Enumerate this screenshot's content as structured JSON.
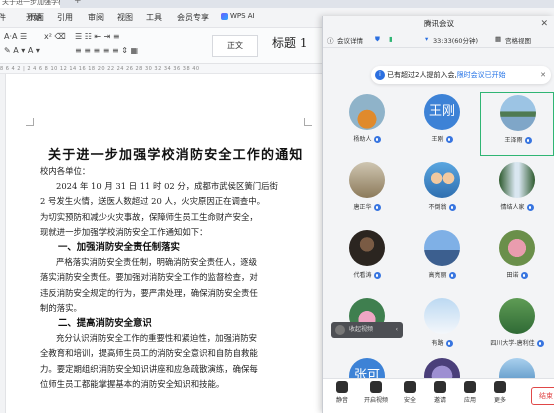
{
  "wps": {
    "file_tab": "关于进一步加强学校消防安全",
    "menu": [
      "文件",
      "开始",
      "插入",
      "页面",
      "引用",
      "审阅",
      "视图",
      "工具",
      "会员专享"
    ],
    "wps_ai": "WPS AI",
    "style_normal": "正文",
    "style_heading1": "标题 1",
    "ruler_text": "8 6 4 2 | 2 4 6 8 10 12 14 16 18 20 22 24 26 28 30 32 34 36 38 40",
    "document": {
      "title": "关于进一步加强学校消防安全工作的通知",
      "salutation": "校内各单位：",
      "para1": [
        "2024 年 10 月 31 日 11 时 02 分，成都市武侯区簧门后街",
        "2 号发生火情，送医人数超过 20 人，火灾原因正在调查中。",
        "为切实预防和减少火灾事故，保障师生员工生命财产安全，",
        "现就进一步加强学校消防安全工作通知如下："
      ],
      "heading1": "一、加强消防安全责任制落实",
      "para2": [
        "严格落实消防安全责任制，明确消防安全责任人，逐级",
        "落实消防安全责任。要加强对消防安全工作的监督检查，对",
        "违反消防安全规定的行为，要严肃处理，确保消防安全责任",
        "制的落实。"
      ],
      "heading2": "二、提高消防安全意识",
      "para3": [
        "充分认识消防安全工作的重要性和紧迫性，加强消防安",
        "全教育和培训，提高师生员工的消防安全意识和自防自救能",
        "力。要定期组织消防安全知识讲座和应急疏散演练，确保每",
        "位师生员工都能掌握基本的消防安全知识和技能。"
      ]
    }
  },
  "meeting": {
    "title": "腾讯会议",
    "bar": {
      "details": "会议详情",
      "timer": "33:33(60分钟)",
      "view": "宫格视图"
    },
    "notice": {
      "text": "已有超过2人提前入会,",
      "link": "限时会议已开始"
    },
    "participants": [
      {
        "name": "杨助人",
        "avatar": "photo-orange"
      },
      {
        "name": "王刚",
        "avatar": "text",
        "avatar_text": "王刚"
      },
      {
        "name": "王泽雨",
        "avatar": "photo-lake",
        "selected": true
      },
      {
        "name": "唐正华",
        "avatar": "photo-person"
      },
      {
        "name": "不倒翁",
        "avatar": "photo-kids"
      },
      {
        "name": "情结人家",
        "avatar": "photo-waterfall"
      },
      {
        "name": "代看涛",
        "avatar": "photo-dark"
      },
      {
        "name": "高亮丽",
        "avatar": "photo-bridge"
      },
      {
        "name": "田诺",
        "avatar": "photo-flower"
      },
      {
        "name": "",
        "avatar": "photo-lotus"
      },
      {
        "name": "有路",
        "avatar": "photo-sky"
      },
      {
        "name": "四川大学-唐利佳",
        "avatar": "photo-green"
      },
      {
        "name": "",
        "avatar": "text-blue",
        "avatar_text": "张可"
      },
      {
        "name": "",
        "avatar": "photo-purple"
      },
      {
        "name": "",
        "avatar": "photo-sea"
      }
    ],
    "collapse_label": "收起视频",
    "footer": [
      "静音",
      "开启视频",
      "安全",
      "邀请",
      "应用",
      "更多"
    ],
    "end_button": "结束"
  }
}
